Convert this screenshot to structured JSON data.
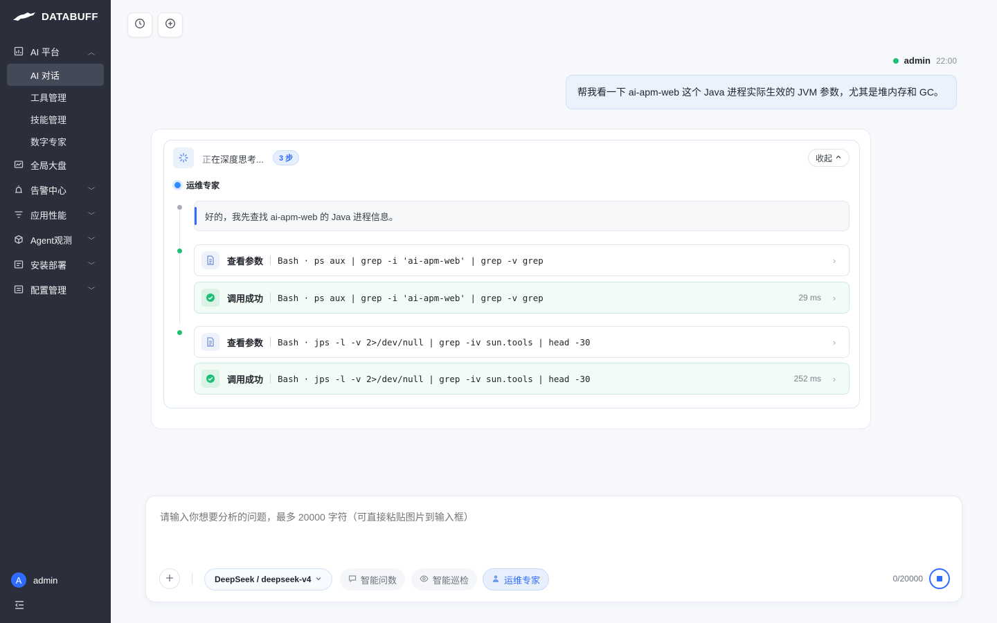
{
  "brand": {
    "name": "DATABUFF"
  },
  "sidebar": {
    "groups": [
      {
        "label": "AI 平台",
        "icon": "ai-chart-icon",
        "expanded": true,
        "children": [
          {
            "label": "AI 对话",
            "active": true
          },
          {
            "label": "工具管理"
          },
          {
            "label": "技能管理"
          },
          {
            "label": "数字专家"
          }
        ]
      },
      {
        "label": "全局大盘",
        "icon": "dashboard-icon"
      },
      {
        "label": "告警中心",
        "icon": "alarm-icon"
      },
      {
        "label": "应用性能",
        "icon": "list-filter-icon"
      },
      {
        "label": "Agent观测",
        "icon": "cube-icon"
      },
      {
        "label": "安装部署",
        "icon": "install-icon"
      },
      {
        "label": "配置管理",
        "icon": "config-icon"
      }
    ],
    "user": {
      "avatar_letter": "A",
      "name": "admin"
    }
  },
  "conversation": {
    "user_message": {
      "author": "admin",
      "time": "22:00",
      "text": "帮我看一下 ai-apm-web 这个 Java 进程实际生效的 JVM 参数，尤其是堆内存和 GC。"
    },
    "thinking": {
      "label_prefix": "正",
      "label_rest": "在深度思考...",
      "steps_badge": "3 步",
      "collapse_label": "收起",
      "agent_name": "运维专家",
      "note": "好的，我先查找 ai-apm-web 的 Java 进程信息。",
      "tool_calls": [
        {
          "kind": "params",
          "title": "查看参数",
          "command": "Bash · ps aux | grep -i 'ai-apm-web' | grep -v grep",
          "duration": ""
        },
        {
          "kind": "success",
          "title": "调用成功",
          "command": "Bash · ps aux | grep -i 'ai-apm-web' | grep -v grep",
          "duration": "29 ms"
        },
        {
          "kind": "params",
          "title": "查看参数",
          "command": "Bash · jps -l -v 2>/dev/null | grep -iv sun.tools | head -30",
          "duration": ""
        },
        {
          "kind": "success",
          "title": "调用成功",
          "command": "Bash · jps -l -v 2>/dev/null | grep -iv sun.tools | head -30",
          "duration": "252 ms"
        }
      ]
    }
  },
  "composer": {
    "placeholder": "请输入你想要分析的问题，最多 20000 字符（可直接粘贴图片到输入框）",
    "model": "DeepSeek / deepseek-v4",
    "modes": [
      {
        "label": "智能问数",
        "icon": "chat-data-icon",
        "active": false
      },
      {
        "label": "智能巡检",
        "icon": "eye-icon",
        "active": false
      },
      {
        "label": "运维专家",
        "icon": "person-icon",
        "active": true
      }
    ],
    "counter": "0/20000"
  },
  "colors": {
    "accent": "#2f6bff",
    "success": "#1fbf75",
    "sidebar_bg": "#2a2f3b"
  }
}
